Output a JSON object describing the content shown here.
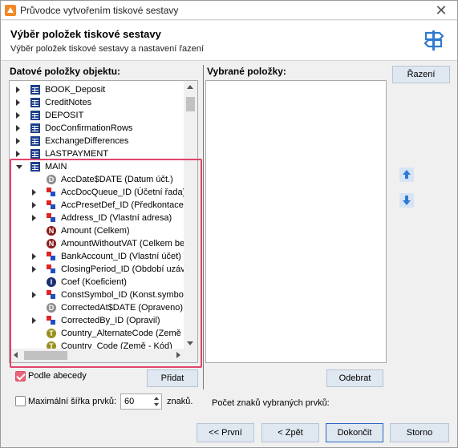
{
  "window": {
    "title": "Průvodce vytvořením tiskové sestavy",
    "close_label": "✕"
  },
  "header": {
    "title": "Výběr položek tiskové sestavy",
    "subtitle": "Výběr položek tiskové sestavy a nastavení řazení",
    "icon": "signpost-icon"
  },
  "left_panel": {
    "label": "Datové položky objektu:",
    "rows": [
      {
        "text": "BOOK_Deposit",
        "icon": "table-icon",
        "expander": "collapsed",
        "level": 0
      },
      {
        "text": "CreditNotes",
        "icon": "table-icon",
        "expander": "collapsed",
        "level": 0
      },
      {
        "text": "DEPOSIT",
        "icon": "table-icon",
        "expander": "collapsed",
        "level": 0
      },
      {
        "text": "DocConfirmationRows",
        "icon": "table-icon",
        "expander": "collapsed",
        "level": 0
      },
      {
        "text": "ExchangeDifferences",
        "icon": "table-icon",
        "expander": "collapsed",
        "level": 0
      },
      {
        "text": "LASTPAYMENT",
        "icon": "table-icon",
        "expander": "collapsed",
        "level": 0
      },
      {
        "text": "MAIN",
        "icon": "table-icon",
        "expander": "expanded",
        "level": 0
      },
      {
        "text": "AccDate$DATE (Datum účt.)",
        "icon": "date-icon",
        "expander": "none",
        "level": 1
      },
      {
        "text": "AccDocQueue_ID (Účetní řada)",
        "icon": "relation-icon",
        "expander": "collapsed",
        "level": 1
      },
      {
        "text": "AccPresetDef_ID (Předkontace)",
        "icon": "relation-icon",
        "expander": "collapsed",
        "level": 1
      },
      {
        "text": "Address_ID (Vlastní adresa)",
        "icon": "relation-icon",
        "expander": "collapsed",
        "level": 1
      },
      {
        "text": "Amount (Celkem)",
        "icon": "number-icon",
        "expander": "none",
        "level": 1
      },
      {
        "text": "AmountWithoutVAT (Celkem bez",
        "icon": "number-icon",
        "expander": "none",
        "level": 1
      },
      {
        "text": "BankAccount_ID (Vlastní účet)",
        "icon": "relation-icon",
        "expander": "collapsed",
        "level": 1
      },
      {
        "text": "ClosingPeriod_ID (Období uzávě",
        "icon": "relation-icon",
        "expander": "collapsed",
        "level": 1
      },
      {
        "text": "Coef (Koeficient)",
        "icon": "integer-icon",
        "expander": "none",
        "level": 1
      },
      {
        "text": "ConstSymbol_ID (Konst.symbol)",
        "icon": "relation-icon",
        "expander": "collapsed",
        "level": 1
      },
      {
        "text": "CorrectedAt$DATE (Opraveno)",
        "icon": "date-icon",
        "expander": "none",
        "level": 1
      },
      {
        "text": "CorrectedBy_ID (Opravil)",
        "icon": "relation-icon",
        "expander": "collapsed",
        "level": 1
      },
      {
        "text": "Country_AlternateCode (Země -",
        "icon": "text-icon",
        "expander": "none",
        "level": 1
      },
      {
        "text": "Country_Code (Země - Kód)",
        "icon": "text-icon",
        "expander": "none",
        "level": 1
      }
    ],
    "sort_alpha_label": "Podle abecedy",
    "sort_alpha_checked": true,
    "add_label": "Přidat"
  },
  "right_panel": {
    "label": "Vybrané položky:",
    "items": [],
    "remove_label": "Odebrat"
  },
  "side_buttons": {
    "sort_label": "Řazení"
  },
  "bottom": {
    "max_width_label": "Maximální šířka prvků:",
    "max_width_checked": false,
    "max_width_value": "60",
    "chars_label": "znaků.",
    "char_count_label": "Počet znaků vybraných prvků:"
  },
  "footer": {
    "first_label": "<< První",
    "back_label": "< Zpět",
    "finish_label": "Dokončit",
    "cancel_label": "Storno"
  },
  "colors": {
    "accent": "#2b66c2",
    "highlight": "#e0456a",
    "checkbox_checked": "#e9667a"
  }
}
